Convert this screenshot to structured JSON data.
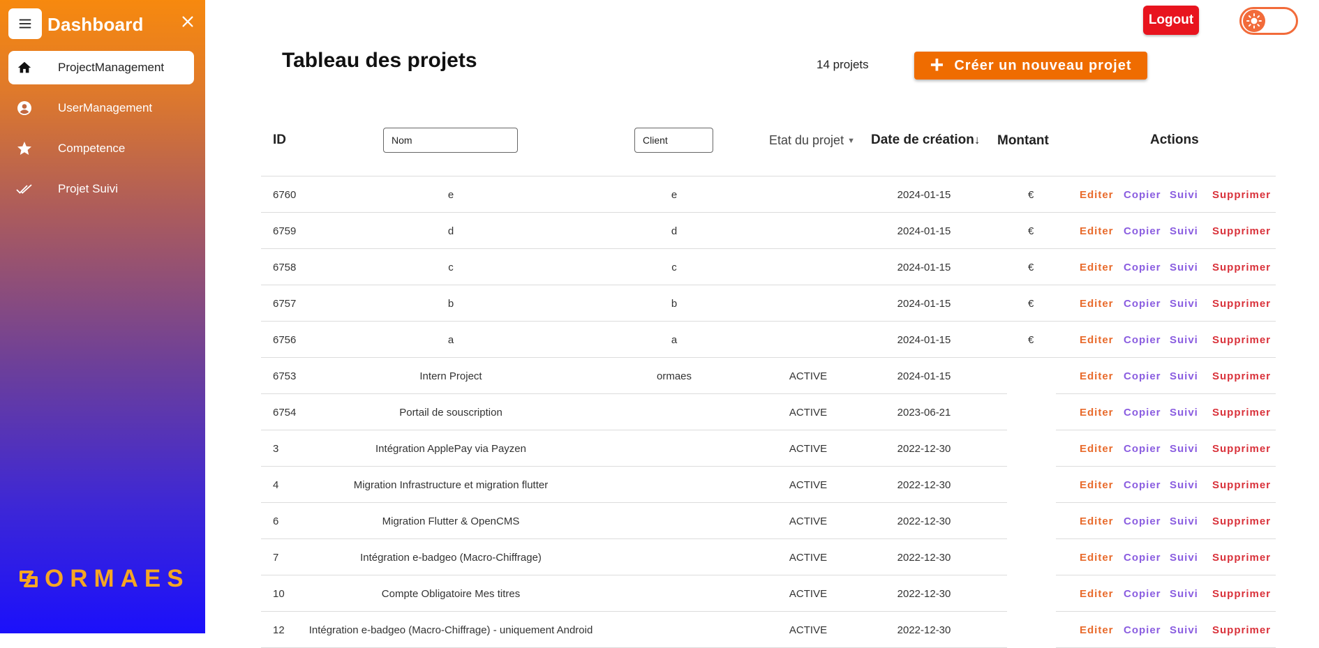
{
  "sidebar": {
    "title": "Dashboard",
    "items": [
      {
        "label": "ProjectManagement",
        "icon": "home-icon",
        "active": true
      },
      {
        "label": "UserManagement",
        "icon": "account-circle-icon",
        "active": false
      },
      {
        "label": "Competence",
        "icon": "star-icon",
        "active": false
      },
      {
        "label": "Projet Suivi",
        "icon": "double-check-icon",
        "active": false
      }
    ],
    "logo_text": "ORMAES"
  },
  "header": {
    "logout_label": "Logout",
    "theme_toggle": "sun-icon"
  },
  "main": {
    "title": "Tableau des projets",
    "count": "14 projets",
    "create_label": "Créer un nouveau projet"
  },
  "table": {
    "headers": {
      "id": "ID",
      "nom_placeholder": "Nom",
      "client_placeholder": "Client",
      "etat": "Etat du projet",
      "date": "Date de création",
      "montant": "Montant",
      "actions": "Actions"
    },
    "actions": {
      "edit": "Editer",
      "copy": "Copier",
      "suivi": "Suivi",
      "delete": "Supprimer"
    },
    "rows": [
      {
        "id": "6760",
        "nom": "e",
        "client": "e",
        "etat": "",
        "date": "2024-01-15",
        "montant": "€"
      },
      {
        "id": "6759",
        "nom": "d",
        "client": "d",
        "etat": "",
        "date": "2024-01-15",
        "montant": "€"
      },
      {
        "id": "6758",
        "nom": "c",
        "client": "c",
        "etat": "",
        "date": "2024-01-15",
        "montant": "€"
      },
      {
        "id": "6757",
        "nom": "b",
        "client": "b",
        "etat": "",
        "date": "2024-01-15",
        "montant": "€"
      },
      {
        "id": "6756",
        "nom": "a",
        "client": "a",
        "etat": "",
        "date": "2024-01-15",
        "montant": "€"
      },
      {
        "id": "6753",
        "nom": "Intern Project",
        "client": "ormaes",
        "etat": "ACTIVE",
        "date": "2024-01-15",
        "montant": ""
      },
      {
        "id": "6754",
        "nom": "Portail de souscription",
        "client": "",
        "etat": "ACTIVE",
        "date": "2023-06-21",
        "montant": ""
      },
      {
        "id": "3",
        "nom": "Intégration ApplePay via Payzen",
        "client": "",
        "etat": "ACTIVE",
        "date": "2022-12-30",
        "montant": ""
      },
      {
        "id": "4",
        "nom": "Migration Infrastructure et migration flutter",
        "client": "",
        "etat": "ACTIVE",
        "date": "2022-12-30",
        "montant": ""
      },
      {
        "id": "6",
        "nom": "Migration Flutter & OpenCMS",
        "client": "",
        "etat": "ACTIVE",
        "date": "2022-12-30",
        "montant": ""
      },
      {
        "id": "7",
        "nom": "Intégration e-badgeo (Macro-Chiffrage)",
        "client": "",
        "etat": "ACTIVE",
        "date": "2022-12-30",
        "montant": ""
      },
      {
        "id": "10",
        "nom": "Compte Obligatoire Mes titres",
        "client": "",
        "etat": "ACTIVE",
        "date": "2022-12-30",
        "montant": ""
      },
      {
        "id": "12",
        "nom": "Intégration e-badgeo (Macro-Chiffrage) - uniquement Android",
        "client": "",
        "etat": "ACTIVE",
        "date": "2022-12-30",
        "montant": ""
      }
    ]
  },
  "colors": {
    "accent": "#ef6c00",
    "logout": "#e8141e",
    "edit": "#e86a2b",
    "copy": "#8a5de0",
    "delete": "#d9313a",
    "logo": "#f5a623"
  }
}
